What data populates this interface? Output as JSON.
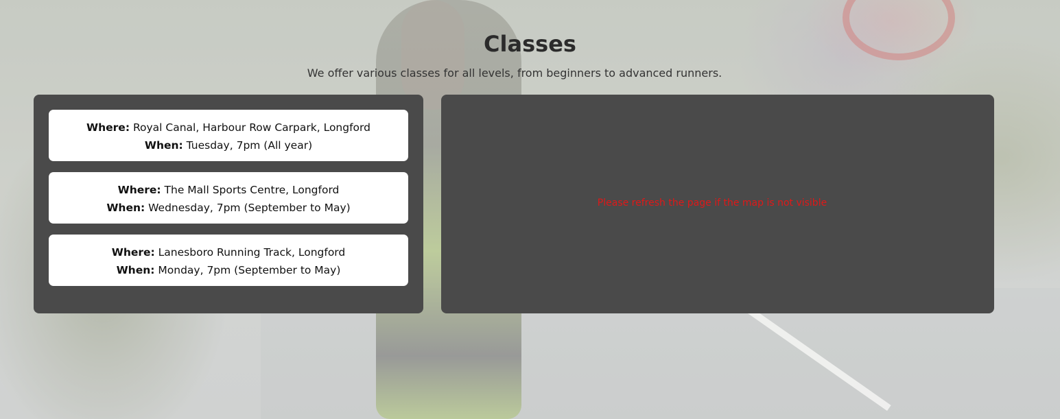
{
  "header": {
    "title": "Classes",
    "subtitle": "We offer various classes for all levels, from beginners to advanced runners."
  },
  "classes": [
    {
      "where_label": "Where:",
      "where": "Royal Canal, Harbour Row Carpark, Longford",
      "when_label": "When:",
      "when": "Tuesday, 7pm (All year)"
    },
    {
      "where_label": "Where:",
      "where": "The Mall Sports Centre, Longford",
      "when_label": "When:",
      "when": "Wednesday, 7pm (September to May)"
    },
    {
      "where_label": "Where:",
      "where": "Lanesboro Running Track, Longford",
      "when_label": "When:",
      "when": "Monday, 7pm (September to May)"
    }
  ],
  "map": {
    "notice": "Please refresh the page if the map is not visible"
  },
  "colors": {
    "panel": "#4a4a4a",
    "card": "#ffffff",
    "notice": "#e01818"
  }
}
